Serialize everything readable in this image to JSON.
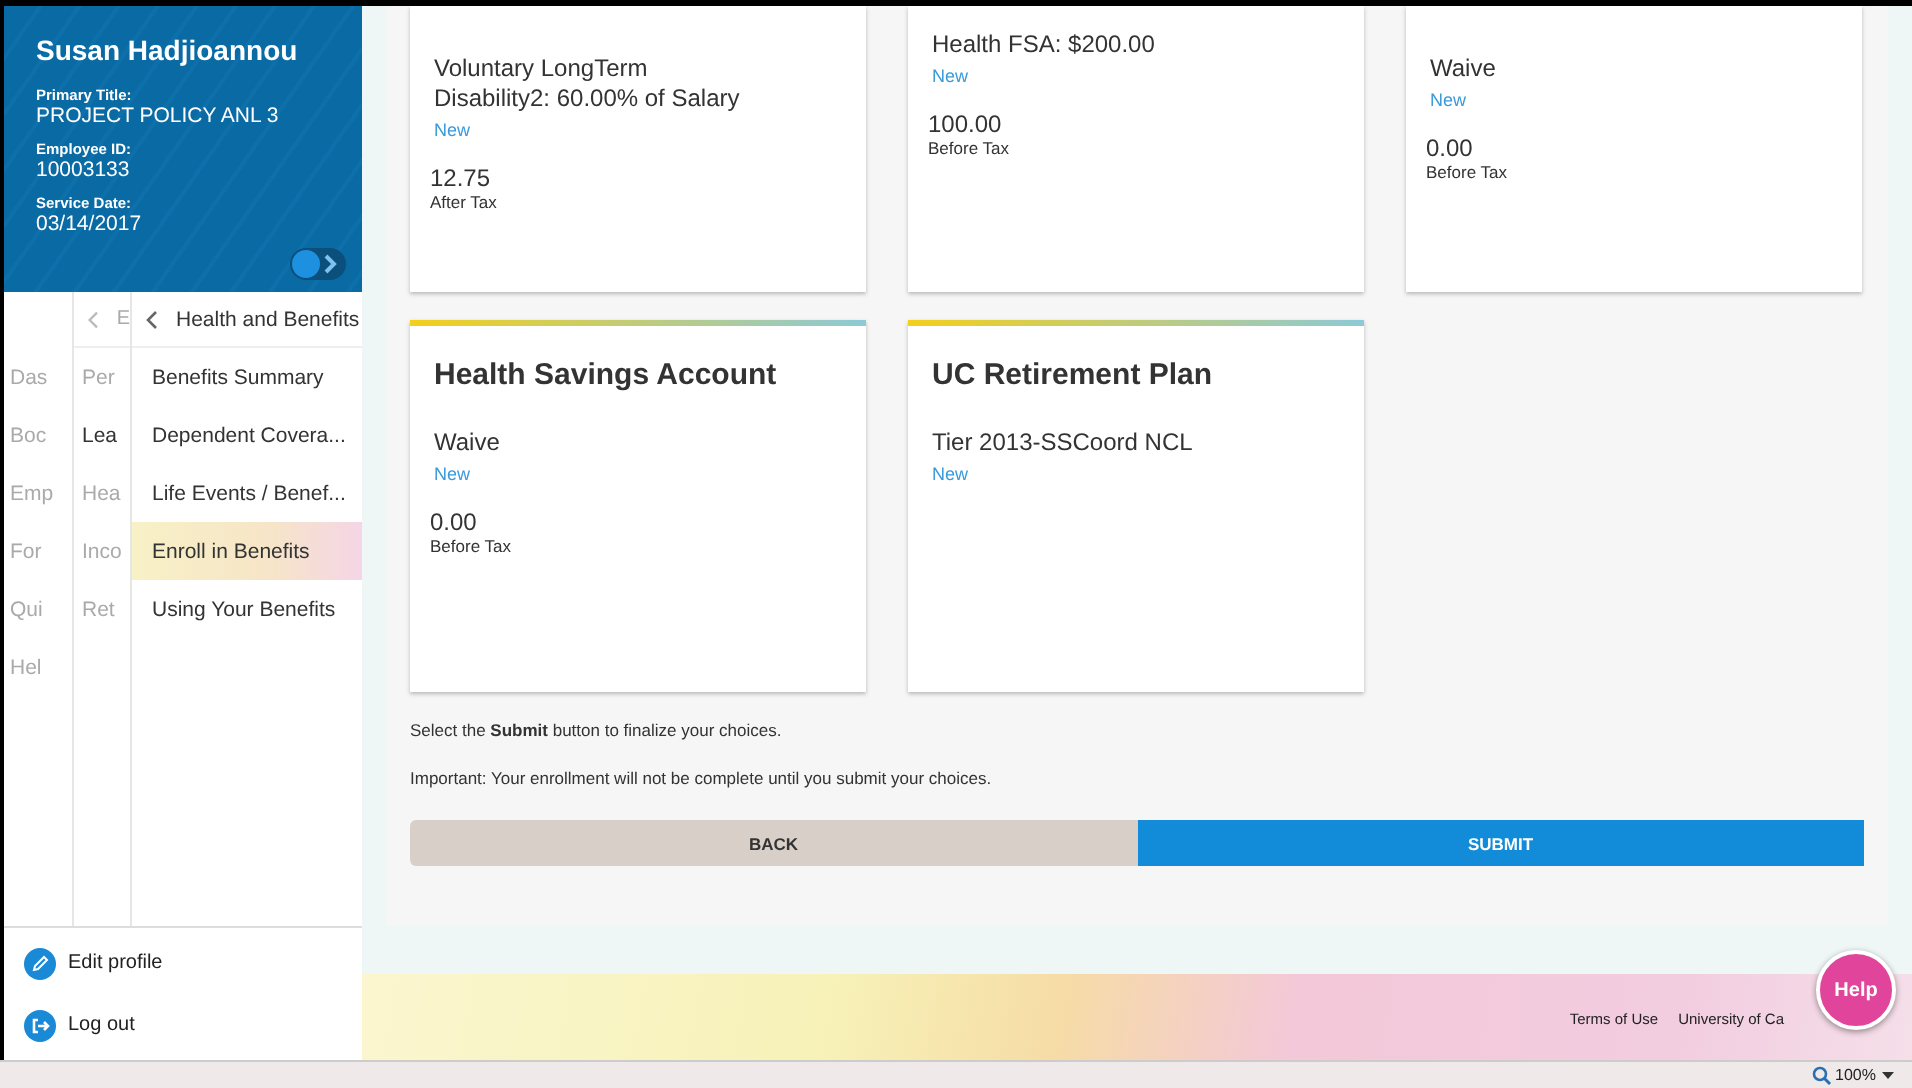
{
  "profile": {
    "name": "Susan Hadjioannou",
    "fields": [
      {
        "label": "Primary Title:",
        "value": "PROJECT POLICY ANL 3"
      },
      {
        "label": "Employee ID:",
        "value": "10003133"
      },
      {
        "label": "Service Date:",
        "value": "03/14/2017"
      }
    ],
    "toggle": {
      "on": true
    }
  },
  "nav_column_1": {
    "items": [
      "Das",
      "Boc",
      "Emp",
      "For",
      "Qui",
      "Hel"
    ]
  },
  "nav_column_2": {
    "header": "E",
    "items": [
      "Per",
      "Lea",
      "Hea",
      "Inco",
      "Ret"
    ]
  },
  "nav_column_3": {
    "header": "Health and Benefits",
    "items": [
      {
        "label": "Benefits Summary",
        "selected": false
      },
      {
        "label": "Dependent Covera...",
        "selected": false
      },
      {
        "label": "Life Events / Benef...",
        "selected": false
      },
      {
        "label": "Enroll in Benefits",
        "selected": true
      },
      {
        "label": "Using Your Benefits",
        "selected": false
      }
    ]
  },
  "account_links": [
    {
      "kind": "edit",
      "label": "Edit profile"
    },
    {
      "kind": "logout",
      "label": "Log out"
    }
  ],
  "cards": [
    {
      "plan": "Voluntary LongTerm Disability2: 60.00% of Salary",
      "status": "New",
      "amount": "12.75",
      "tax": "After Tax",
      "accent_bar": false
    },
    {
      "plan": "Health FSA: $200.00",
      "status": "New",
      "amount": "100.00",
      "tax": "Before Tax",
      "accent_bar": false
    },
    {
      "plan": "Waive",
      "status": "New",
      "amount": "0.00",
      "tax": "Before Tax",
      "accent_bar": false
    },
    {
      "title": "Health Savings Account",
      "plan": "Waive",
      "status": "New",
      "amount": "0.00",
      "tax": "Before Tax",
      "accent_bar": true
    },
    {
      "title": "UC Retirement Plan",
      "plan": "Tier 2013-SSCoord NCL",
      "status": "New",
      "accent_bar": true
    }
  ],
  "instructions": [
    "Select the **Submit** button to finalize your choices.",
    "Important: Your enrollment will not be complete until you submit your choices."
  ],
  "buttons": {
    "back": "BACK",
    "submit": "SUBMIT"
  },
  "footer": {
    "links": [
      "Terms of Use",
      "University of Ca"
    ],
    "help": "Help"
  },
  "status_bar": {
    "zoom": "100%"
  }
}
